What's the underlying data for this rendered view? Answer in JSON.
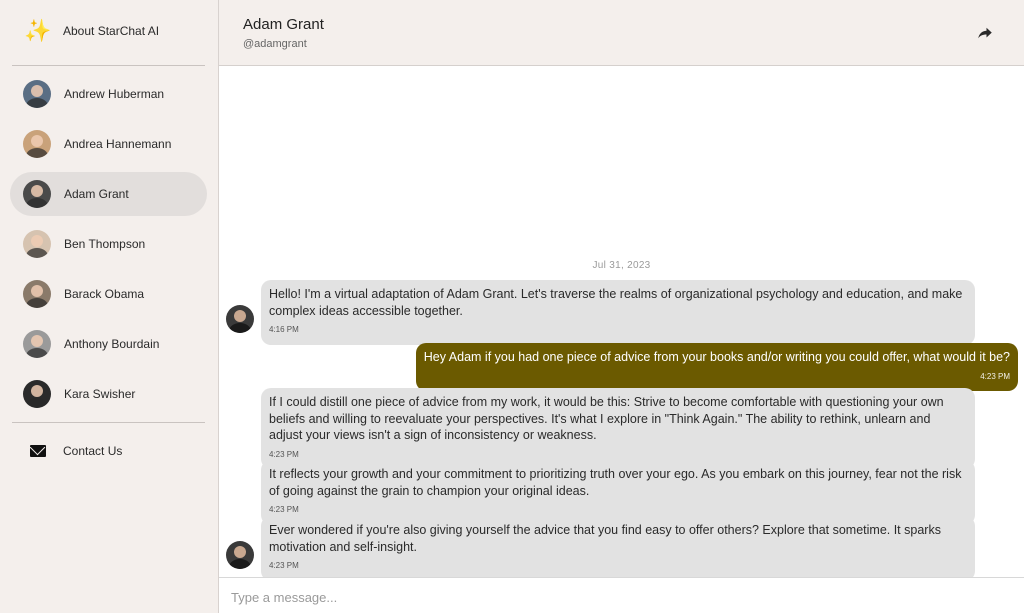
{
  "sidebar": {
    "about_label": "About StarChat AI",
    "contacts": [
      {
        "label": "Andrew Huberman",
        "avatar_color": "#5a6e84"
      },
      {
        "label": "Andrea Hannemann",
        "avatar_color": "#c9a27a"
      },
      {
        "label": "Adam Grant",
        "avatar_color": "#4a4a4a"
      },
      {
        "label": "Ben Thompson",
        "avatar_color": "#d6c3b0"
      },
      {
        "label": "Barack Obama",
        "avatar_color": "#8a7a6a"
      },
      {
        "label": "Anthony Bourdain",
        "avatar_color": "#9a9a9a"
      },
      {
        "label": "Kara Swisher",
        "avatar_color": "#2a2a2a"
      }
    ],
    "contact_us_label": "Contact Us"
  },
  "header": {
    "name": "Adam Grant",
    "handle": "@adamgrant"
  },
  "chat": {
    "date": "Jul 31, 2023",
    "messages": [
      {
        "sender": "bot",
        "text": "Hello! I'm a virtual adaptation of Adam Grant. Let's traverse the realms of organizational psychology and education, and make complex ideas accessible together.",
        "time": "4:16 PM"
      },
      {
        "sender": "user",
        "text": "Hey Adam if you had one piece of advice from your books and/or writing you could offer, what would it be?",
        "time": "4:23 PM"
      },
      {
        "sender": "bot",
        "text": "If I could distill one piece of advice from my work, it would be this: Strive to become comfortable with questioning your own beliefs and willing to reevaluate your perspectives. It's what I explore in \"Think Again.\" The ability to rethink, unlearn and adjust your views isn't a sign of inconsistency or weakness.",
        "time": "4:23 PM"
      },
      {
        "sender": "bot",
        "text": "It reflects your growth and your commitment to prioritizing truth over your ego. As you embark on this journey, fear not the risk of going against the grain to champion your original ideas.",
        "time": "4:23 PM"
      },
      {
        "sender": "bot",
        "text": "Ever wondered if you're also giving yourself the advice that you find easy to offer others? Explore that sometime. It sparks motivation and self-insight.",
        "time": "4:23 PM"
      }
    ]
  },
  "composer": {
    "placeholder": "Type a message..."
  },
  "colors": {
    "sidebar_bg": "#f4efec",
    "user_bubble": "#6b5a00",
    "bot_bubble": "#e2e2e2",
    "active_item": "#e2dedc"
  }
}
